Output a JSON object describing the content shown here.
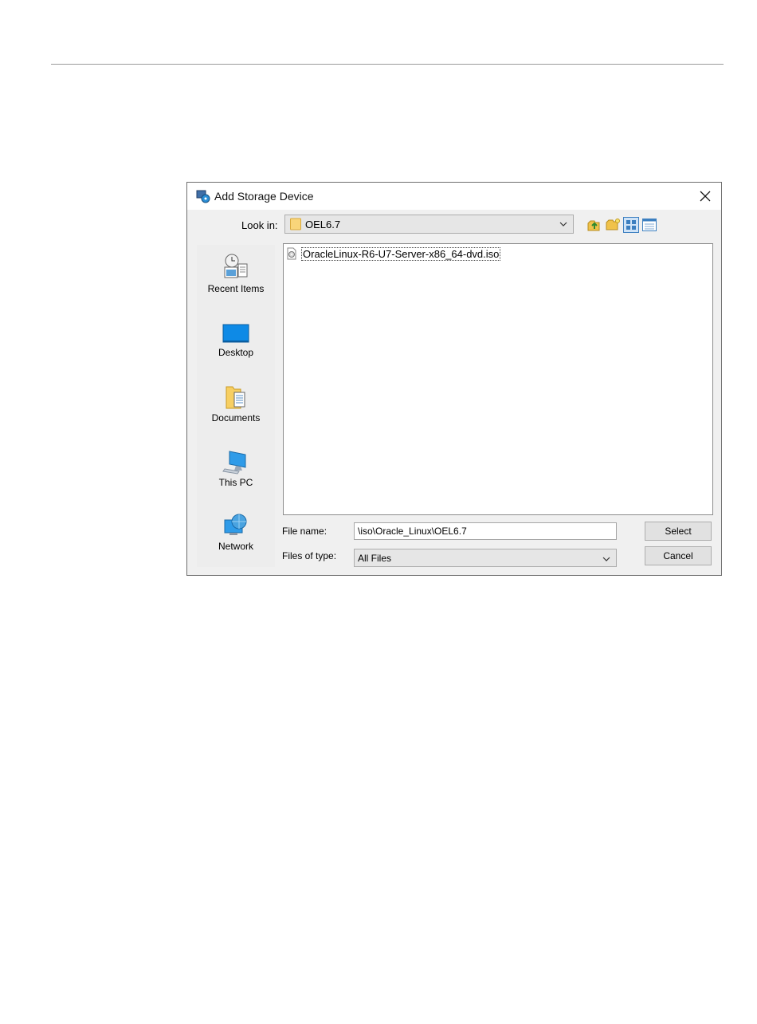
{
  "dialog": {
    "title": "Add Storage Device",
    "look_in_label": "Look in:",
    "look_in_value": "OEL6.7",
    "toolbar": [
      "up-one-level-icon",
      "new-folder-icon",
      "list-view-icon",
      "details-view-icon"
    ],
    "places": [
      {
        "label": "Recent Items",
        "icon": "recent-items-icon"
      },
      {
        "label": "Desktop",
        "icon": "desktop-icon"
      },
      {
        "label": "Documents",
        "icon": "documents-icon"
      },
      {
        "label": "This PC",
        "icon": "this-pc-icon"
      },
      {
        "label": "Network",
        "icon": "network-icon"
      }
    ],
    "files": [
      {
        "name": "OracleLinux-R6-U7-Server-x86_64-dvd.iso",
        "icon": "iso-file-icon"
      }
    ],
    "file_name_label": "File name:",
    "file_name_value": "\\iso\\Oracle_Linux\\OEL6.7",
    "files_of_type_label": "Files of type:",
    "files_of_type_value": "All Files",
    "select_label": "Select",
    "cancel_label": "Cancel"
  }
}
